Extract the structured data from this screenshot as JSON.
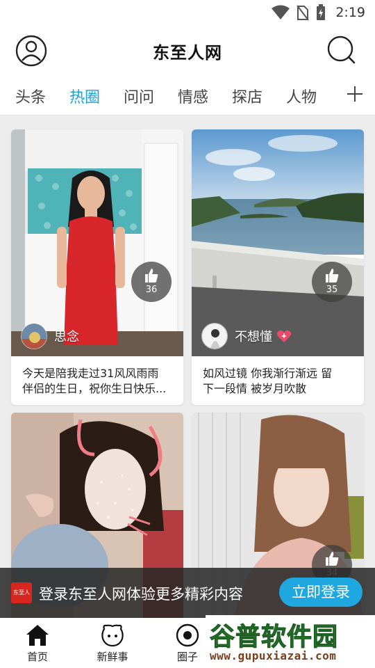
{
  "status_bar": {
    "time": "2:19",
    "icons": [
      "wifi-icon",
      "no-sim-icon",
      "battery-charging-icon"
    ]
  },
  "header": {
    "title": "东至人网",
    "left_icon": "user-icon",
    "right_icon": "search-icon"
  },
  "tabs": {
    "items": [
      "头条",
      "热圈",
      "问问",
      "情感",
      "探店",
      "人物"
    ],
    "active_index": 1,
    "add_icon": "plus-icon"
  },
  "colors": {
    "accent": "#16a3d8",
    "login_button": "#1fa7e0",
    "heart": "#e84a6a",
    "logo_red": "#d7261f"
  },
  "feed": [
    {
      "likes": "36",
      "author": "思念",
      "caption_lines": [
        "今天是陪我走过31风风雨雨",
        "伴侣的生日，祝你生日快乐..."
      ]
    },
    {
      "likes": "35",
      "author": "不想懂",
      "has_heart": true,
      "caption_lines": [
        "如风过镜  你我渐行渐远   留",
        "下一段情   被岁月吹散"
      ]
    },
    {
      "likes": "",
      "author": "",
      "caption_lines": []
    },
    {
      "likes": "34",
      "author": "",
      "caption_lines": []
    }
  ],
  "login_banner": {
    "logo_text": "东至人",
    "text": "登录东至人网体验更多精彩内容",
    "button": "立即登录"
  },
  "bottom_nav": [
    {
      "label": "首页",
      "icon": "home-icon"
    },
    {
      "label": "新鲜事",
      "icon": "face-icon"
    },
    {
      "label": "圈子",
      "icon": "circle-icon"
    }
  ],
  "watermark": {
    "title": "谷普软件园",
    "url": "www.gupuxiazai.com"
  }
}
